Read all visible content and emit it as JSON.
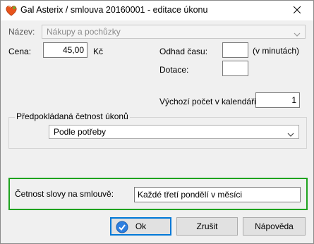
{
  "window": {
    "title": "Gal Asterix / smlouva 20160001 - editace úkonu",
    "title_icon": "heart-icon",
    "close_icon": "close-icon"
  },
  "form": {
    "nazev_label": "Název:",
    "nazev_value": "Nákupy a pochůzky",
    "cena_label": "Cena:",
    "cena_value": "45,00",
    "cena_unit": "Kč",
    "odhad_label": "Odhad času:",
    "odhad_value": "",
    "odhad_unit": "(v minutách)",
    "dotace_label": "Dotace:",
    "dotace_value": "",
    "vychozi_label": "Výchozí počet v kalendáři:",
    "vychozi_value": "1"
  },
  "group": {
    "legend": "Předpokládaná četnost úkonů",
    "select_value": "Podle potřeby"
  },
  "frequency": {
    "label": "Četnost slovy na smlouvě:",
    "value": "Každé třetí pondělí v měsíci"
  },
  "buttons": {
    "ok": "Ok",
    "cancel": "Zrušit",
    "help": "Nápověda"
  },
  "colors": {
    "highlight_border": "#1fa31f",
    "default_button_border": "#0078d7"
  }
}
